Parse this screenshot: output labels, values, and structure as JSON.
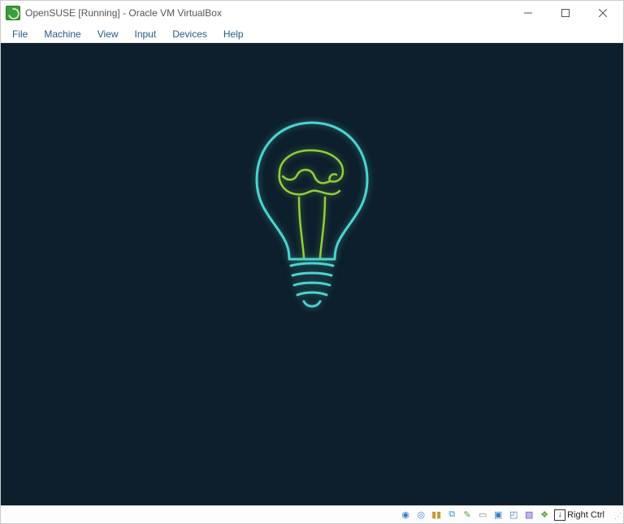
{
  "window": {
    "title": "OpenSUSE [Running] - Oracle VM VirtualBox"
  },
  "menu": {
    "items": [
      "File",
      "Machine",
      "View",
      "Input",
      "Devices",
      "Help"
    ]
  },
  "status": {
    "icons": [
      "hard-disk-icon",
      "optical-disc-icon",
      "audio-icon",
      "network-icon",
      "usb-icon",
      "shared-folder-icon",
      "display-icon",
      "recording-icon",
      "cpu-icon",
      "mouse-integration-icon"
    ],
    "host_key": "Right Ctrl"
  },
  "guest": {
    "boot_logo": "opensuse-lightbulb"
  }
}
